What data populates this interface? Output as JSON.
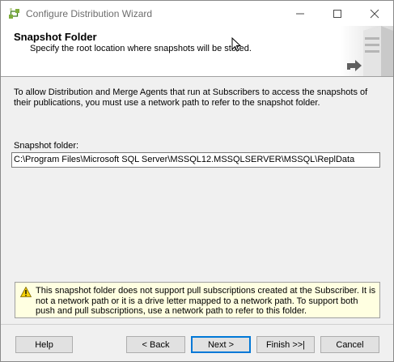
{
  "window": {
    "title": "Configure Distribution Wizard",
    "app_icon": "wizard-app-icon"
  },
  "window_controls": {
    "minimize_icon": "minimize-icon",
    "maximize_icon": "maximize-icon",
    "close_icon": "close-icon"
  },
  "header": {
    "title": "Snapshot Folder",
    "subtitle": "Specify the root location where snapshots will be stored.",
    "graphic_icon": "server-graphic-icon"
  },
  "main": {
    "info_text": "To allow Distribution and Merge Agents that run at Subscribers to access the snapshots of their publications, you must use a network path to refer to the snapshot folder.",
    "snapshot_folder_label": "Snapshot folder:",
    "snapshot_folder_value": "C:\\Program Files\\Microsoft SQL Server\\MSSQL12.MSSQLSERVER\\MSSQL\\ReplData"
  },
  "warning": {
    "icon": "warning-icon",
    "text": "This snapshot folder does not support pull subscriptions created at the Subscriber. It is not a network path or it is a drive letter mapped to a network path. To support both push and pull subscriptions, use a network path to refer to this folder."
  },
  "buttons": {
    "help": "Help",
    "back": "< Back",
    "next": "Next >",
    "finish": "Finish >>|",
    "cancel": "Cancel"
  },
  "colors": {
    "accent": "#0078d7",
    "warning_background": "#ffffe1",
    "dialog_background": "#f0f0f0"
  }
}
